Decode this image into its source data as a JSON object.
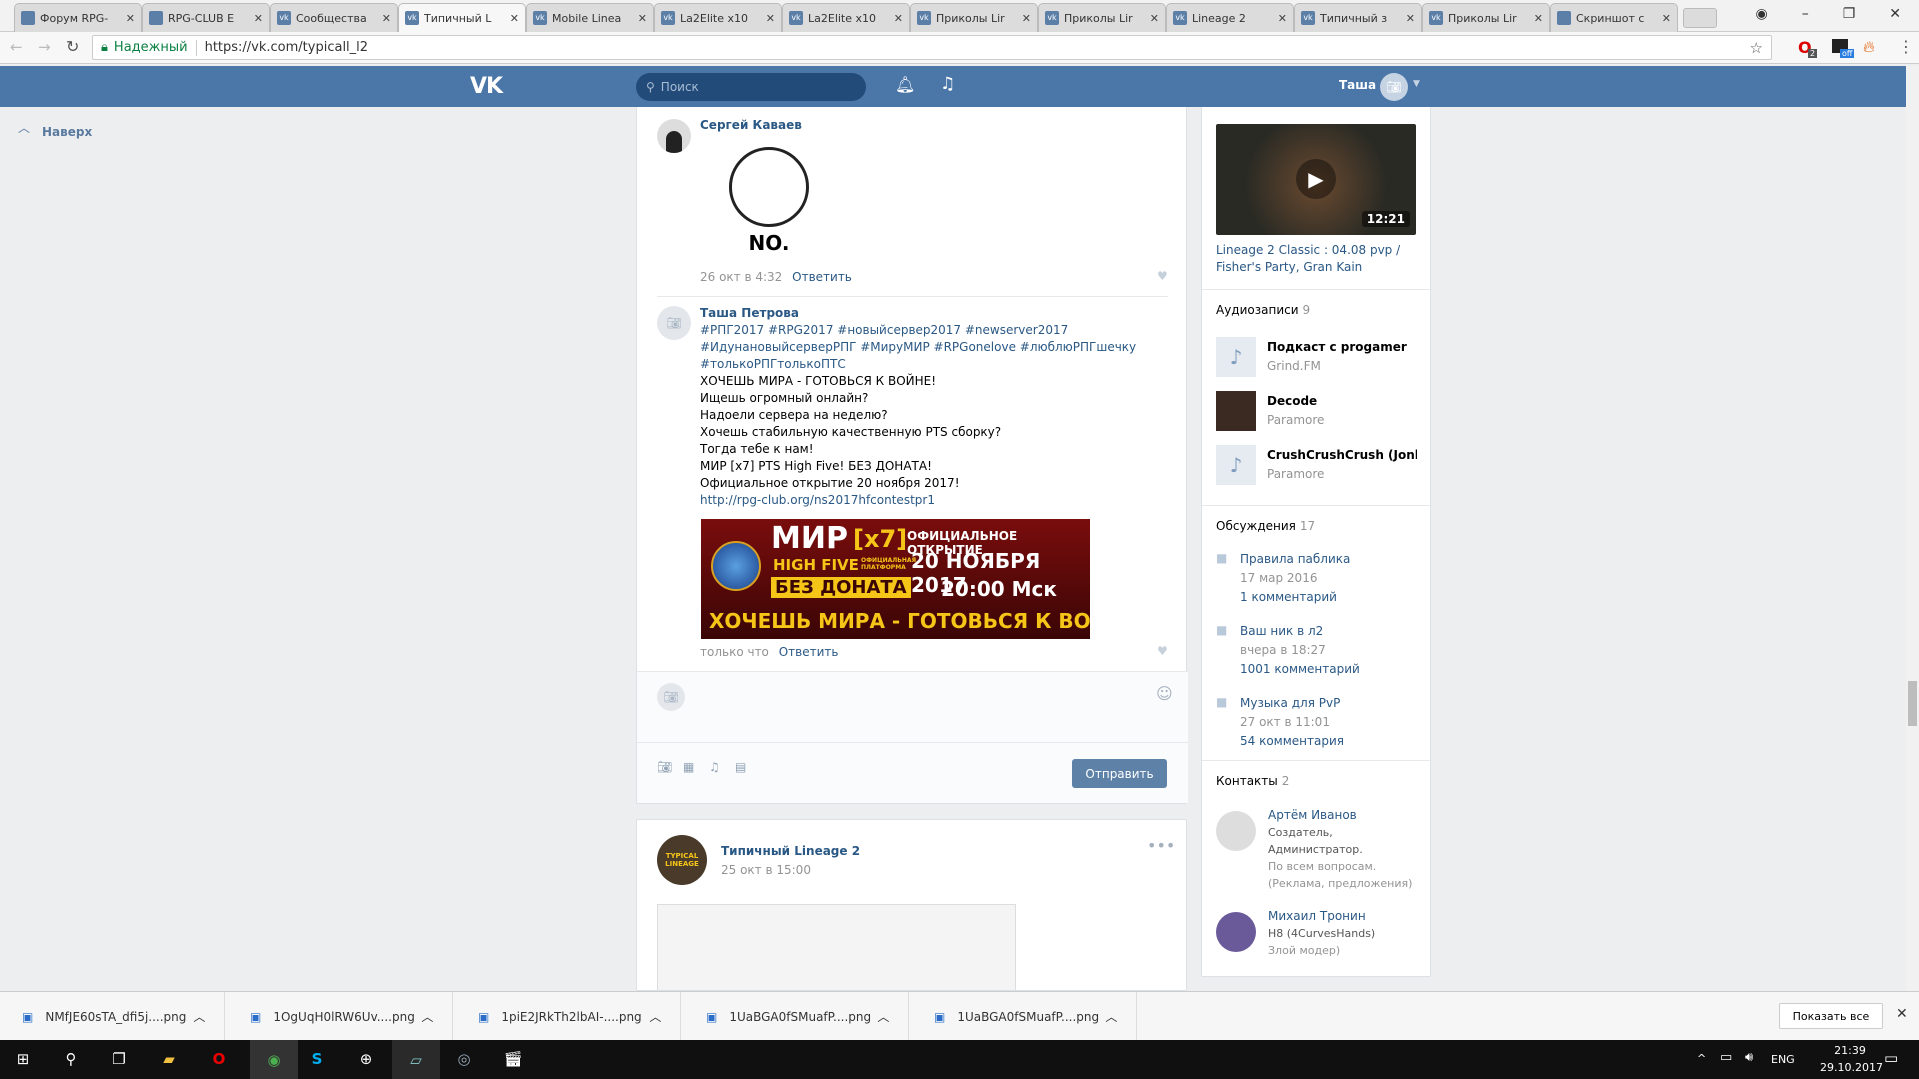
{
  "browser": {
    "tabs": [
      {
        "label": "Форум RPG-",
        "icon": "rpg-forum-icon"
      },
      {
        "label": "RPG-CLUB E",
        "icon": "rpg-club-icon"
      },
      {
        "label": "Сообщества",
        "icon": "vk-icon"
      },
      {
        "label": "Типичный L",
        "icon": "vk-icon",
        "active": true
      },
      {
        "label": "Mobile Linea",
        "icon": "vk-icon"
      },
      {
        "label": "La2Elite x10",
        "icon": "vk-icon"
      },
      {
        "label": "La2Elite x10",
        "icon": "vk-icon"
      },
      {
        "label": "Приколы Lir",
        "icon": "vk-icon"
      },
      {
        "label": "Приколы Lir",
        "icon": "vk-icon"
      },
      {
        "label": "Lineage 2",
        "icon": "vk-icon"
      },
      {
        "label": "Типичный з",
        "icon": "vk-icon"
      },
      {
        "label": "Приколы Lir",
        "icon": "vk-icon"
      },
      {
        "label": "Скриншот с",
        "icon": "feather-icon"
      }
    ],
    "secure_label": "Надежный",
    "url": "https://vk.com/typicall_l2",
    "ext_badges": {
      "opera": "2",
      "ext2": "off"
    }
  },
  "vk": {
    "search_placeholder": "Поиск",
    "user_name": "Таша",
    "back_to_top": "Наверх"
  },
  "comments": [
    {
      "author": "Сергей Каваев",
      "meme_text": "NO.",
      "date": "26 окт в 4:32",
      "reply": "Ответить"
    },
    {
      "author": "Таша Петрова",
      "hashtags": [
        "#РПГ2017 #RPG2017 #новыйсервер2017 #newserver2017",
        "#ИдунановыйсерверРПГ #МируМИР #RPGonelove #люблюРПГшечку",
        "#толькоРПГтолькоПТС"
      ],
      "lines": [
        "ХОЧЕШЬ МИРА - ГОТОВЬСЯ К ВОЙНЕ!",
        "Ищешь огромный онлайн?",
        "Надоели сервера на неделю?",
        "Хочешь стабильную качественную PTS сборку?",
        "Тогда тебе к нам!",
        "МИР [x7] PTS High Five! БЕЗ ДОНАТА!",
        "Официальное открытие 20 ноября 2017!"
      ],
      "link": "http://rpg-club.org/ns2017hfcontestpr1",
      "banner": {
        "title": "МИР",
        "rate": "[x7]",
        "sub": "HIGH FIVE",
        "platform": "ОФИЦИАЛЬНАЯ ПЛАТФОРМА",
        "nodonate": "БЕЗ ДОНАТА",
        "open": "ОФИЦИАЛЬНОЕ ОТКРЫТИЕ",
        "date": "20 НОЯБРЯ 2017",
        "time": "20:00 Мск",
        "slogan": "ХОЧЕШЬ МИРА - ГОТОВЬСЯ К ВОЙНЕ"
      },
      "date": "только что",
      "reply": "Ответить"
    }
  ],
  "composer": {
    "send_label": "Отправить"
  },
  "post": {
    "author": "Типичный Lineage 2",
    "date": "25 окт в 15:00",
    "avatar_text": "TYPICAL LINEAGE"
  },
  "sidebar": {
    "video": {
      "duration": "12:21",
      "title": "Lineage 2 Classic : 04.08 pvp / Fisher's Party, Gran Kain"
    },
    "audio": {
      "header": "Аудиозаписи",
      "count": "9",
      "tracks": [
        {
          "title": "Подкаст с progamer",
          "artist": "Grind.FM"
        },
        {
          "title": "Decode",
          "artist": "Paramore"
        },
        {
          "title": "CrushCrushCrush (Jonbr...",
          "artist": "Paramore"
        }
      ]
    },
    "discussions": {
      "header": "Обсуждения",
      "count": "17",
      "items": [
        {
          "title": "Правила паблика",
          "date": "17 мар 2016",
          "comments": "1 комментарий"
        },
        {
          "title": "Ваш ник в л2",
          "date": "вчера в 18:27",
          "comments": "1001 комментарий"
        },
        {
          "title": "Музыка для PvP",
          "date": "27 окт в 11:01",
          "comments": "54 комментария"
        }
      ]
    },
    "contacts": {
      "header": "Контакты",
      "count": "2",
      "items": [
        {
          "name": "Артём Иванов",
          "role": "Создатель, Администратор.",
          "note": "По всем вопросам. (Реклама, предложения)"
        },
        {
          "name": "Михаил Тронин",
          "role": "H8 (4CurvesHands)",
          "note": "Злой модер)"
        }
      ]
    }
  },
  "downloads": {
    "files": [
      "NMfJE60sTA_dfi5j....png",
      "1OgUqH0lRW6Uv....png",
      "1piE2JRkTh2lbAI-....png",
      "1UaBGA0fSMuafP....png",
      "1UaBGA0fSMuafP....png"
    ],
    "show_all": "Показать все"
  },
  "taskbar": {
    "lang": "ENG",
    "time": "21:39",
    "date": "29.10.2017"
  }
}
